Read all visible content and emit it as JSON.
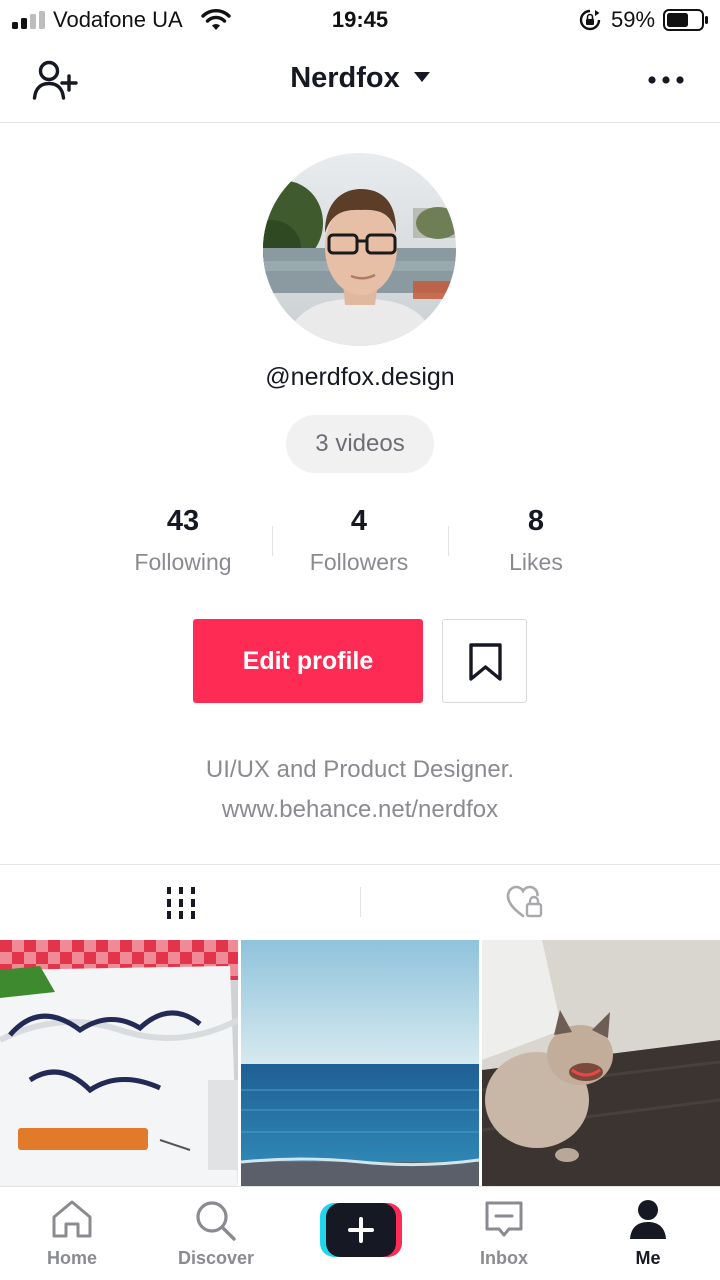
{
  "status_bar": {
    "carrier": "Vodafone UA",
    "time": "19:45",
    "battery": "59%"
  },
  "header": {
    "title": "Nerdfox"
  },
  "profile": {
    "username": "@nerdfox.design",
    "videos_count": "3 videos",
    "stats": [
      {
        "value": "43",
        "label": "Following"
      },
      {
        "value": "4",
        "label": "Followers"
      },
      {
        "value": "8",
        "label": "Likes"
      }
    ],
    "edit_label": "Edit profile",
    "bio_line1": "UI/UX and Product Designer.",
    "bio_line2": "www.behance.net/nerdfox"
  },
  "tabs": [
    {
      "icon": "grid-icon",
      "selected": true
    },
    {
      "icon": "liked-private-icon",
      "selected": false
    }
  ],
  "bottom_nav": [
    {
      "label": "Home",
      "icon": "home-icon"
    },
    {
      "label": "Discover",
      "icon": "search-icon"
    },
    {
      "label": "",
      "icon": "create-plus-icon"
    },
    {
      "label": "Inbox",
      "icon": "inbox-icon"
    },
    {
      "label": "Me",
      "icon": "profile-icon",
      "active": true
    }
  ],
  "colors": {
    "accent": "#fe2c55",
    "text": "#161823",
    "secondary": "#8a8b91"
  }
}
